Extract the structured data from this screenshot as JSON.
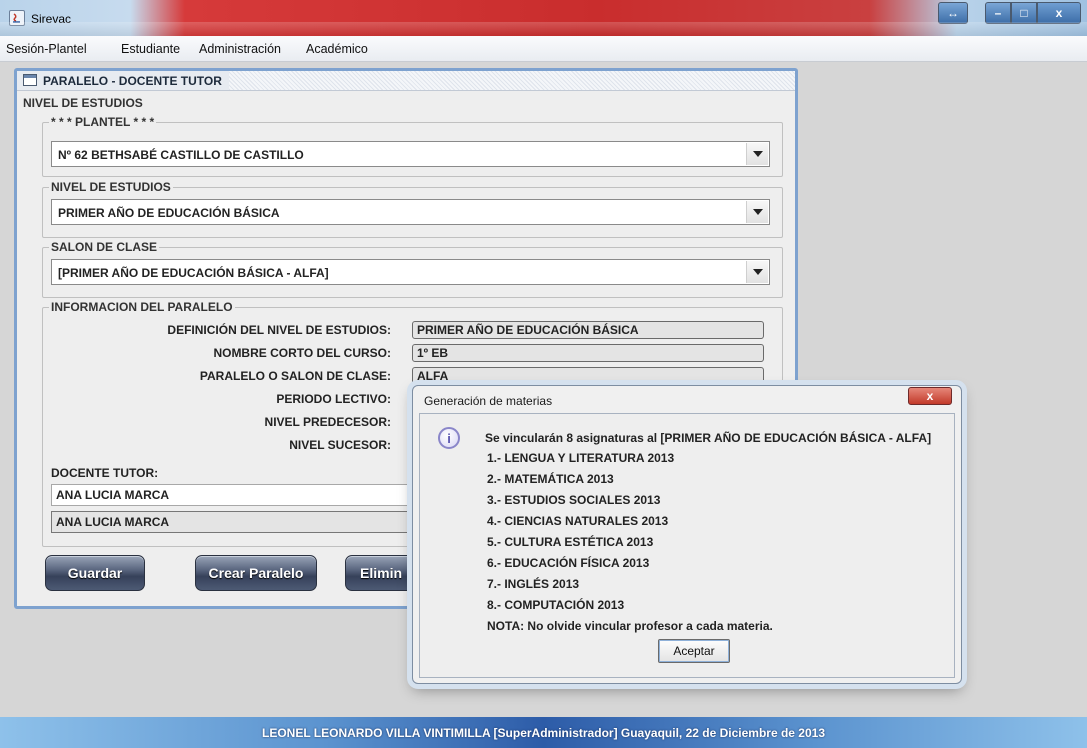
{
  "window": {
    "title": "Sirevac",
    "resize_label": "↔",
    "minimize_label": "–",
    "maximize_label": "□",
    "close_label": "x"
  },
  "menu": {
    "items": [
      "Sesión-Plantel",
      "Estudiante",
      "Administración",
      "Académico"
    ]
  },
  "frame": {
    "title": "PARALELO - DOCENTE TUTOR",
    "outer_group": "NIVEL DE ESTUDIOS",
    "plantel": {
      "label": "* * * PLANTEL * * *",
      "value": "Nº 62 BETHSABÉ CASTILLO DE CASTILLO"
    },
    "nivel": {
      "label": "NIVEL DE ESTUDIOS",
      "value": "PRIMER AÑO DE EDUCACIÓN BÁSICA"
    },
    "salon": {
      "label": "SALON DE CLASE",
      "value": "[PRIMER AÑO DE EDUCACIÓN BÁSICA  -  ALFA]"
    },
    "info": {
      "label": "INFORMACION DEL PARALELO",
      "rows": [
        {
          "label": "DEFINICIÓN DEL NIVEL DE ESTUDIOS:",
          "value": "PRIMER AÑO DE EDUCACIÓN BÁSICA"
        },
        {
          "label": "NOMBRE CORTO DEL CURSO:",
          "value": "1º EB"
        },
        {
          "label": "PARALELO O SALON DE CLASE:",
          "value": "ALFA"
        },
        {
          "label": "PERIODO LECTIVO:",
          "value": ""
        },
        {
          "label": "NIVEL PREDECESOR:",
          "value": ""
        },
        {
          "label": "NIVEL SUCESOR:",
          "value": ""
        }
      ],
      "tutor_label": "DOCENTE TUTOR:",
      "tutor_value": "ANA LUCIA MARCA",
      "tutor_combo_value": "ANA LUCIA MARCA"
    },
    "buttons": {
      "save": "Guardar",
      "create": "Crear Paralelo",
      "delete": "Elimin"
    }
  },
  "dialog": {
    "title": "Generación de materias",
    "close_label": "x",
    "header": "Se vincularán 8 asignaturas al [PRIMER AÑO DE EDUCACIÓN BÁSICA  -  ALFA]",
    "subjects": [
      "1.- LENGUA Y LITERATURA  2013",
      "2.- MATEMÁTICA  2013",
      "3.- ESTUDIOS SOCIALES  2013",
      "4.- CIENCIAS NATURALES  2013",
      "5.- CULTURA ESTÉTICA  2013",
      "6.- EDUCACIÓN FÍSICA  2013",
      "7.- INGLÉS  2013",
      "8.- COMPUTACIÓN  2013"
    ],
    "note": "NOTA: No olvide vincular profesor a cada materia.",
    "accept": "Aceptar"
  },
  "status": {
    "text": "LEONEL LEONARDO VILLA VINTIMILLA [SuperAdministrador]  Guayaquil, 22 de Diciembre de 2013"
  }
}
